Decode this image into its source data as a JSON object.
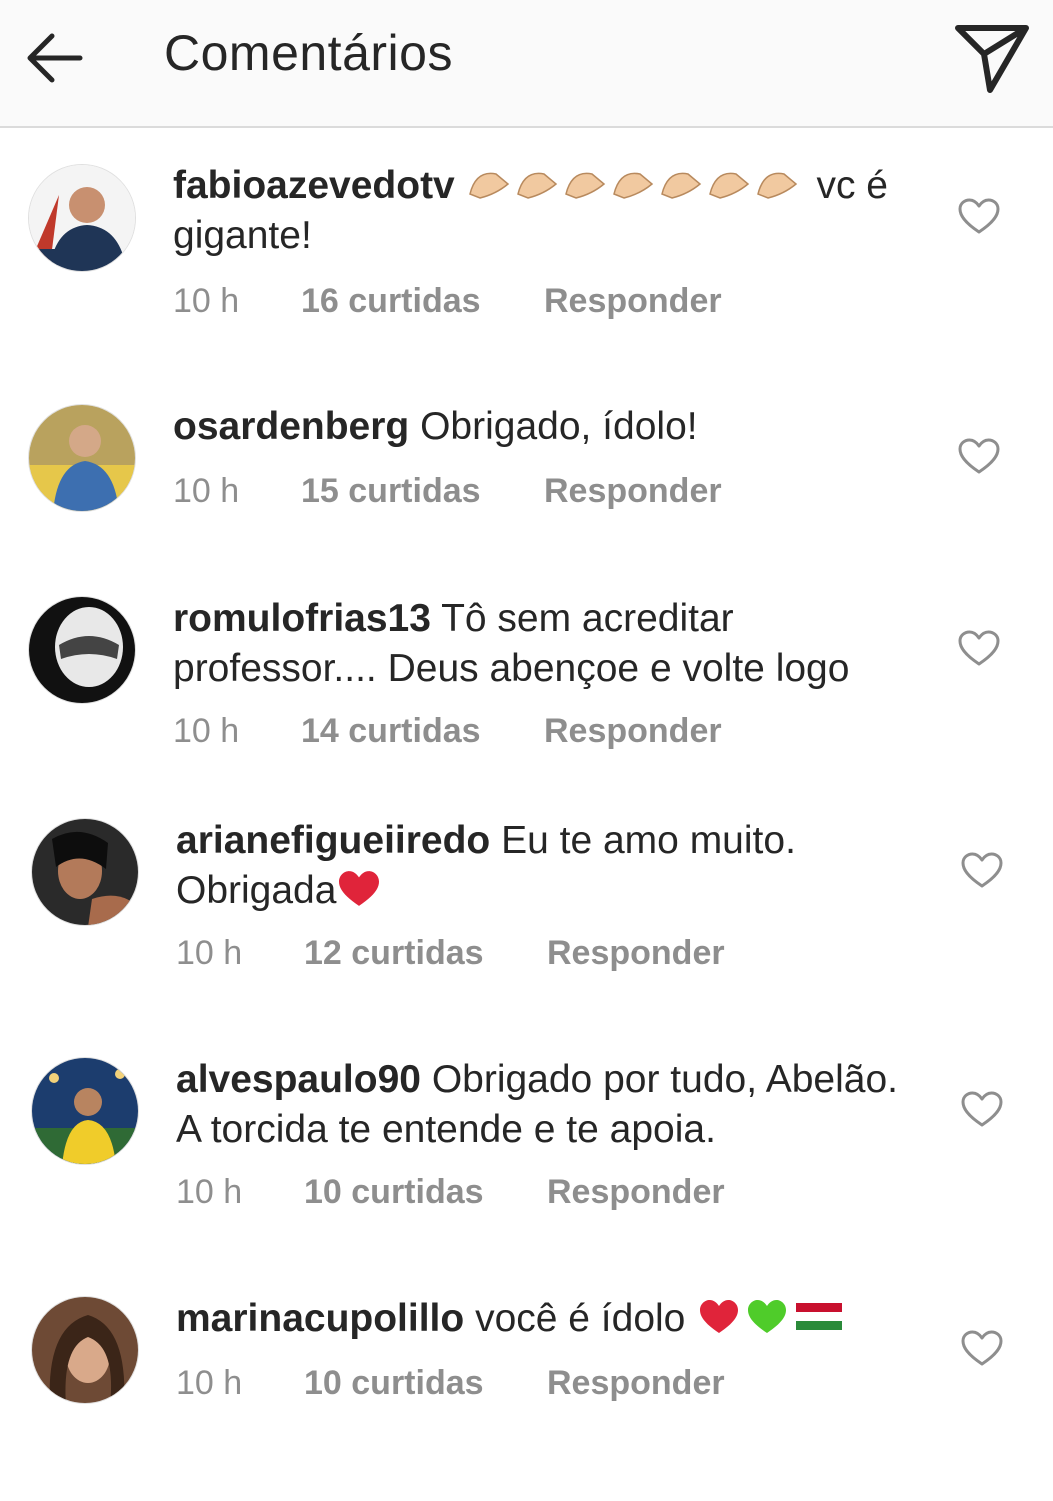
{
  "header": {
    "title": "Comentários"
  },
  "comments": [
    {
      "username": "fabioazevedotv",
      "text_after": "vc é gigante!",
      "emoji": "clapping-hands-x7",
      "time": "10 h",
      "likes": "16 curtidas",
      "reply": "Responder"
    },
    {
      "username": "osardenberg",
      "text": "Obrigado, ídolo!",
      "time": "10 h",
      "likes": "15 curtidas",
      "reply": "Responder"
    },
    {
      "username": "romulofrias13",
      "text": "Tô sem acreditar professor.... Deus abençoe e volte logo",
      "time": "10 h",
      "likes": "14 curtidas",
      "reply": "Responder"
    },
    {
      "username": "arianefigueiiredo",
      "text": "Eu te amo muito. Obrigada",
      "emoji": "red-heart",
      "time": "10 h",
      "likes": "12 curtidas",
      "reply": "Responder"
    },
    {
      "username": "alvespaulo90",
      "text": "Obrigado por tudo, Abelão. A torcida te entende e te apoia.",
      "time": "10 h",
      "likes": "10 curtidas",
      "reply": "Responder"
    },
    {
      "username": "marinacupolillo",
      "text": "você é ídolo",
      "emoji": "red-heart green-heart flag",
      "time": "10 h",
      "likes": "10 curtidas",
      "reply": "Responder"
    }
  ],
  "colors": {
    "text": "#262626",
    "meta": "#8e8e8e",
    "header_bg": "#fafafa"
  }
}
